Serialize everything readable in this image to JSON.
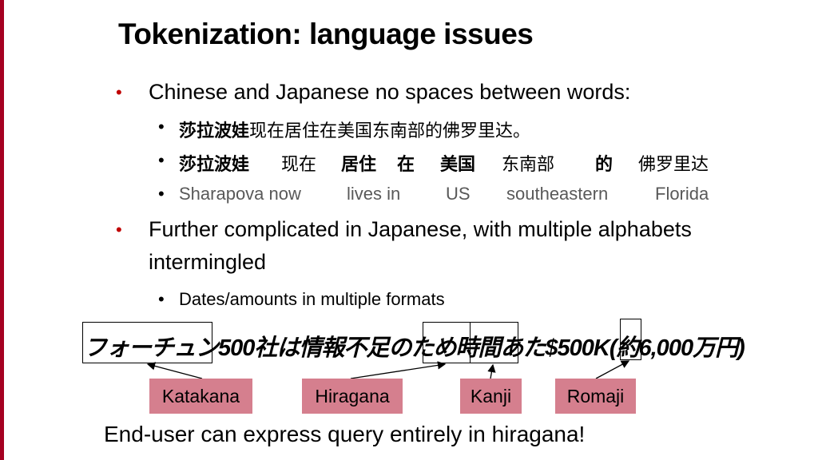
{
  "slide": {
    "title": "Tokenization: language issues",
    "bullets": [
      {
        "text": "Chinese and Japanese no spaces between words:",
        "sub": [
          {
            "parts": [
              {
                "t": "莎拉波娃",
                "bold": true
              },
              {
                "t": "现在居住在美国东南部的佛罗里达。",
                "bold": false
              }
            ]
          },
          {
            "segments": [
              "莎拉波娃",
              "现在",
              "居住",
              "在",
              "美国",
              "东南部",
              "的",
              "佛罗里达"
            ]
          },
          {
            "segments": [
              "Sharapova now",
              "lives in",
              "US",
              "southeastern",
              "Florida"
            ]
          }
        ]
      },
      {
        "text_line1": "Further complicated in Japanese, with multiple alphabets",
        "text_line2": "intermingled",
        "sub": [
          {
            "text": "Dates/amounts in multiple formats"
          }
        ]
      }
    ],
    "bullet_dot": "•",
    "japanese_example": "フォーチュン500社は情報不足のため時間あた$500K(約6,000万円)",
    "labels": [
      "Katakana",
      "Hiragana",
      "Kanji",
      "Romaji"
    ],
    "footer": "End-user can express query entirely in hiragana!",
    "colors": {
      "accent_bar": "#a50021",
      "bullet_red": "#c00000",
      "label_bg": "#d57f8e",
      "gray_text": "#595959"
    }
  }
}
